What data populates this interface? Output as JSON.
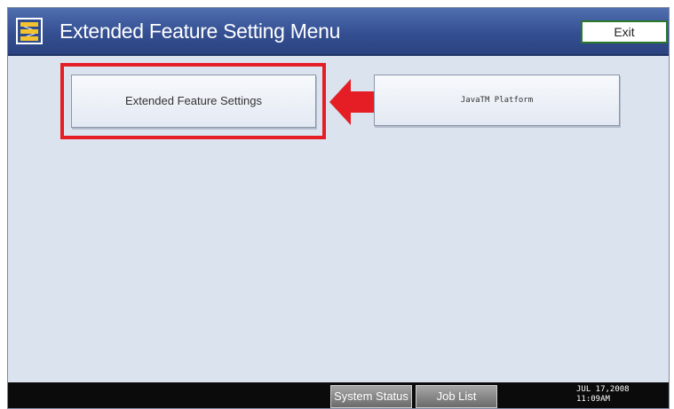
{
  "header": {
    "title": "Extended Feature Setting Menu",
    "exit_label": "Exit",
    "icon": "menu-settings-icon"
  },
  "main": {
    "extended_feature_settings_label": "Extended Feature Settings",
    "java_platform_label": "JavaTM Platform",
    "callout": "red-arrow-left"
  },
  "footer": {
    "system_status_label": "System Status",
    "job_list_label": "Job List",
    "date": "JUL 17,2008",
    "time": "11:09AM"
  },
  "colors": {
    "title_bar": "#344f92",
    "panel": "#dbe3ee",
    "highlight": "#e51e25",
    "exit_border": "#2a7a2a",
    "footer": "#0b0b0b"
  }
}
